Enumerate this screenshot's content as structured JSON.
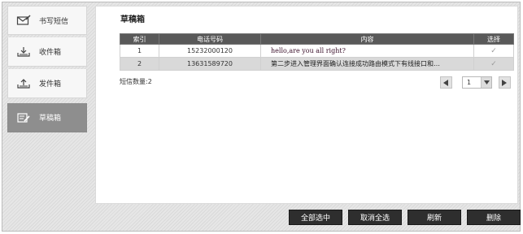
{
  "sidebar": {
    "items": [
      {
        "label": "书写短信",
        "icon": "compose-envelope-icon"
      },
      {
        "label": "收件箱",
        "icon": "inbox-tray-icon"
      },
      {
        "label": "发件箱",
        "icon": "outbox-tray-icon"
      },
      {
        "label": "草稿箱",
        "icon": "drafts-pencil-icon",
        "active": true
      }
    ]
  },
  "main": {
    "title": "草稿箱",
    "table": {
      "headers": [
        "索引",
        "电话号码",
        "内容",
        "选择"
      ],
      "rows": [
        {
          "index": "1",
          "phone": "15232000120",
          "content": "hello,are you all right?"
        },
        {
          "index": "2",
          "phone": "13631589720",
          "content": "第二步进入管理界面确认连接成功路由模式下有线接口和…"
        }
      ]
    },
    "count_label": "短信数量:2",
    "pager": {
      "current_page": "1"
    }
  },
  "actions": {
    "select_all": "全部选中",
    "deselect_all": "取消全选",
    "refresh": "刷新",
    "delete": "删除"
  },
  "colors": {
    "header_bg": "#595959",
    "active_nav_bg": "#8e8e8e",
    "button_bg": "#2e2e2e"
  }
}
